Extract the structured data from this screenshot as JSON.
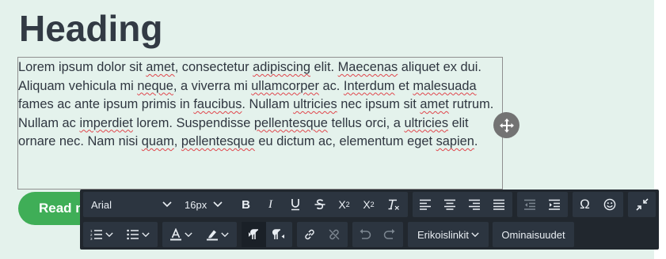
{
  "page": {
    "heading": "Heading",
    "paragraph": [
      {
        "t": "Lorem ipsum dolor sit "
      },
      {
        "t": "amet",
        "s": true
      },
      {
        "t": ", consectetur "
      },
      {
        "t": "adipiscing",
        "s": true
      },
      {
        "t": " elit. "
      },
      {
        "t": "Maecenas",
        "s": true
      },
      {
        "t": " aliquet ex dui. Aliquam vehicula mi "
      },
      {
        "t": "neque",
        "s": true
      },
      {
        "t": ", a viverra mi "
      },
      {
        "t": "ullamcorper",
        "s": true
      },
      {
        "t": " ac. "
      },
      {
        "t": "Interdum",
        "s": true
      },
      {
        "t": " et "
      },
      {
        "t": "malesuada",
        "s": true
      },
      {
        "t": " fames ac ante ipsum primis in "
      },
      {
        "t": "faucibus",
        "s": true
      },
      {
        "t": ". Nullam "
      },
      {
        "t": "ultricies",
        "s": true
      },
      {
        "t": " nec ipsum sit "
      },
      {
        "t": "amet",
        "s": true
      },
      {
        "t": " rutrum. Nullam ac "
      },
      {
        "t": "imperdiet",
        "s": true
      },
      {
        "t": " lorem. Suspendisse "
      },
      {
        "t": "pellentesque",
        "s": true
      },
      {
        "t": " tellus orci, a "
      },
      {
        "t": "ultricies",
        "s": true
      },
      {
        "t": " elit ornare nec. Nam nisi "
      },
      {
        "t": "quam",
        "s": true
      },
      {
        "t": ", "
      },
      {
        "t": "pellentesque",
        "s": true
      },
      {
        "t": " eu dictum ac, elementum eget "
      },
      {
        "t": "sapien",
        "s": true
      },
      {
        "t": "."
      }
    ],
    "button_label": "Read more"
  },
  "toolbar": {
    "font_family": "Arial",
    "font_size": "16px",
    "special_links": "Erikoislinkit",
    "properties": "Ominaisuudet"
  },
  "colors": {
    "background": "#e4f2ec",
    "toolbar": "#21272e",
    "button": "#3fae57",
    "spellcheck": "#e0454b"
  },
  "icons": {
    "row1": [
      "bold",
      "italic",
      "underline",
      "strikethrough",
      "superscript",
      "subscript",
      "clear-format",
      "align-left",
      "align-center",
      "align-right",
      "align-justify",
      "outdent",
      "indent",
      "special-char",
      "emoji",
      "collapse"
    ],
    "row2": [
      "ordered-list",
      "unordered-list",
      "text-color",
      "highlight",
      "ltr",
      "rtl",
      "link",
      "unlink",
      "undo",
      "redo"
    ]
  }
}
